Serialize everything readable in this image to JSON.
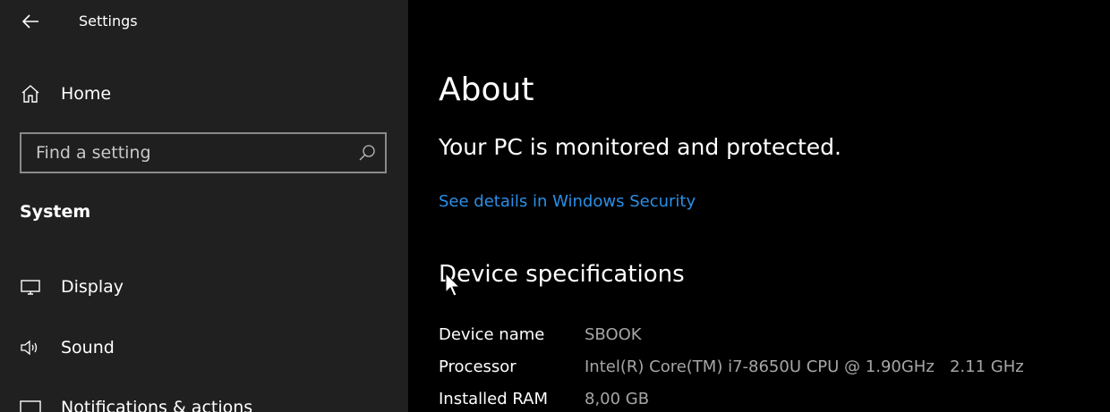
{
  "window": {
    "title": "Settings"
  },
  "sidebar": {
    "home_label": "Home",
    "search_placeholder": "Find a setting",
    "section_label": "System",
    "items": [
      {
        "label": "Display",
        "icon": "monitor-icon"
      },
      {
        "label": "Sound",
        "icon": "speaker-icon"
      },
      {
        "label": "Notifications & actions",
        "icon": "notification-icon"
      }
    ]
  },
  "main": {
    "page_title": "About",
    "status_heading": "Your PC is monitored and protected.",
    "security_link": "See details in Windows Security",
    "specs_heading": "Device specifications",
    "specs": [
      {
        "key": "Device name",
        "value": "SBOOK"
      },
      {
        "key": "Processor",
        "value": "Intel(R) Core(TM) i7-8650U CPU @ 1.90GHz   2.11 GHz"
      },
      {
        "key": "Installed RAM",
        "value": "8,00 GB"
      }
    ]
  },
  "colors": {
    "sidebar_bg": "#202020",
    "main_bg": "#000000",
    "link": "#2b8fe6",
    "value_text": "#a6a6a6"
  }
}
